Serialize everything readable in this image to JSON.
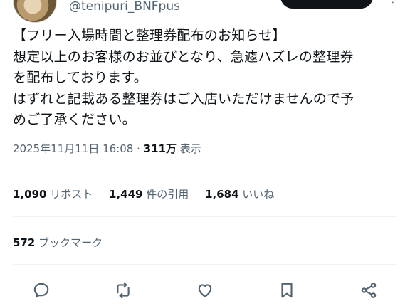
{
  "author": {
    "handle": "@tenipuri_BNFpus"
  },
  "tweet": {
    "lines": [
      "【フリー入場時間と整理券配布のお知らせ】",
      "想定以上のお客様のお並びとなり、急遽ハズレの整理券",
      "を配布しております。",
      "はずれと記載ある整理券はご入店いただけませんので予",
      "めご了承ください。"
    ],
    "timestamp": "2025年11月11日 16:08",
    "separator": " · ",
    "views_count": "311万",
    "views_label": " 表示"
  },
  "stats": {
    "reposts_count": "1,090",
    "reposts_label": "リポスト",
    "quotes_count": "1,449",
    "quotes_label": "件の引用",
    "likes_count": "1,684",
    "likes_label": "いいね",
    "bookmarks_count": "572",
    "bookmarks_label": "ブックマーク"
  },
  "icons": {
    "reply": "reply-icon",
    "repost": "repost-icon",
    "like": "like-icon",
    "bookmark": "bookmark-icon",
    "share": "share-icon"
  },
  "colors": {
    "text": "#0f1419",
    "secondary": "#536471",
    "divider": "#eff3f4"
  }
}
